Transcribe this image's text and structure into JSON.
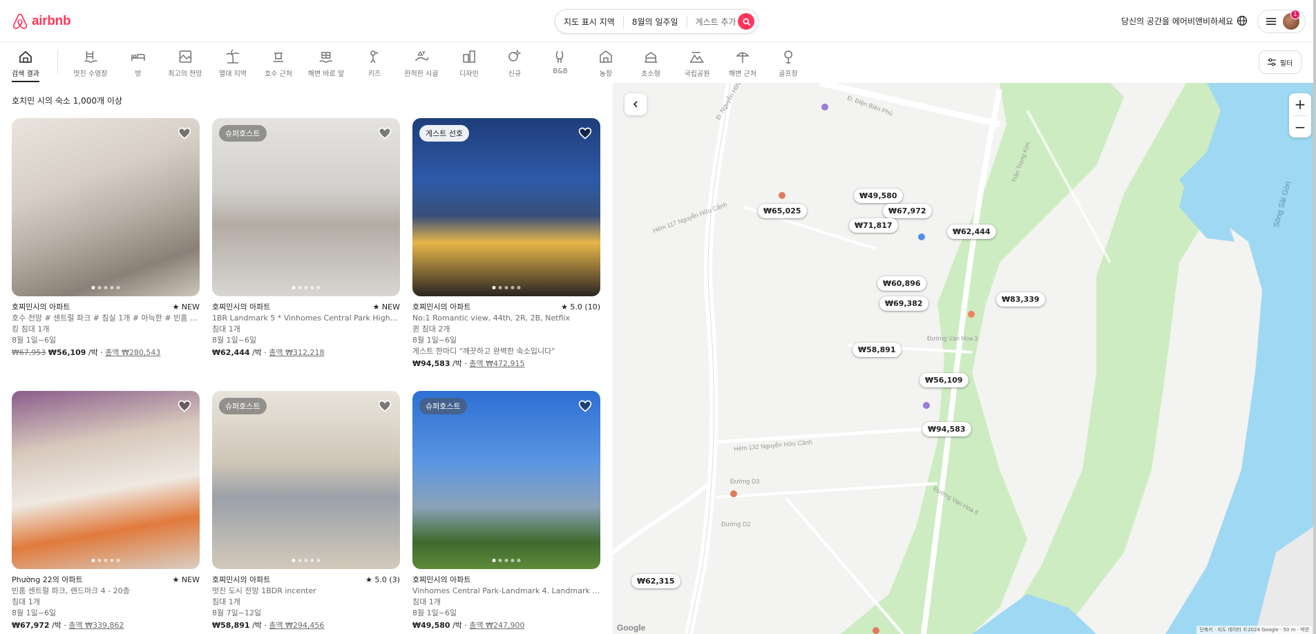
{
  "brand": {
    "name": "airbnb",
    "color": "#ff385c"
  },
  "search": {
    "location": "지도 표시 지역",
    "dates": "8월의 일주일",
    "guests": "게스트 추가"
  },
  "header": {
    "host_link": "당신의 공간을 에어비앤비하세요",
    "notification_count": "1"
  },
  "categories": [
    {
      "label": "검색 결과",
      "icon": "search-results-icon",
      "active": true
    },
    {
      "label": "멋진 수영장",
      "icon": "pool-icon"
    },
    {
      "label": "방",
      "icon": "bed-icon"
    },
    {
      "label": "최고의 전망",
      "icon": "view-icon"
    },
    {
      "label": "열대 지역",
      "icon": "palm-icon"
    },
    {
      "label": "호수 근처",
      "icon": "lake-icon"
    },
    {
      "label": "해변 바로 앞",
      "icon": "beachfront-icon"
    },
    {
      "label": "키즈",
      "icon": "kids-icon"
    },
    {
      "label": "한적한 시골",
      "icon": "countryside-icon"
    },
    {
      "label": "디자인",
      "icon": "design-icon"
    },
    {
      "label": "신규",
      "icon": "new-icon"
    },
    {
      "label": "B&B",
      "icon": "bnb-icon"
    },
    {
      "label": "농장",
      "icon": "farm-icon"
    },
    {
      "label": "초소형",
      "icon": "tiny-home-icon"
    },
    {
      "label": "국립공원",
      "icon": "national-park-icon"
    },
    {
      "label": "해변 근처",
      "icon": "beach-icon"
    },
    {
      "label": "골프장",
      "icon": "golf-icon"
    }
  ],
  "filter_label": "필터",
  "results_count": "호치민 시의 숙소 1,000개 이상",
  "listings": [
    {
      "title": "호찌민시의 아파트",
      "rating": "★ NEW",
      "desc": "호수 전망 # 센트럴 파크 # 침실 1개 # 아늑한 # 빈홈 #...",
      "beds": "킹 침대 1개",
      "dates": "8월 1일~6일",
      "old_price": "₩67,953",
      "price": "₩56,109",
      "per": " /박 · ",
      "total": "총액 ₩280,543",
      "badge": ""
    },
    {
      "title": "호찌민시의 아파트",
      "rating": "★ NEW",
      "desc": "1BR Landmark 5 * Vinhomes Central Park High Floor",
      "beds": "침대 1개",
      "dates": "8월 1일~6일",
      "old_price": "",
      "price": "₩62,444",
      "per": " /박 · ",
      "total": "총액 ₩312,218",
      "badge": "슈퍼호스트"
    },
    {
      "title": "호찌민시의 아파트",
      "rating": "★ 5.0 (10)",
      "desc": "No:1 Romantic view, 44th, 2R, 2B, Netflix",
      "beds": "퀸 침대 2개",
      "dates": "8월 1일~6일",
      "extra": "게스트 한마디 \"깨끗하고 완벽한 숙소입니다\"",
      "old_price": "",
      "price": "₩94,583",
      "per": " /박 · ",
      "total": "총액 ₩472,915",
      "badge": "게스트 선호"
    },
    {
      "title": "Phường 22의 아파트",
      "rating": "★ NEW",
      "desc": "빈홈 센트럴 파크, 랜드마크 4 - 20층",
      "beds": "침대 1개",
      "dates": "8월 1일~6일",
      "old_price": "",
      "price": "₩67,972",
      "per": " /박 · ",
      "total": "총액 ₩339,862",
      "badge": ""
    },
    {
      "title": "호찌민시의 아파트",
      "rating": "★ 5.0 (3)",
      "desc": "멋진 도시 전망 1BDR incenter",
      "beds": "침대 1개",
      "dates": "8월 7일~12일",
      "old_price": "",
      "price": "₩58,891",
      "per": " /박 · ",
      "total": "총액 ₩294,456",
      "badge": "슈퍼호스트"
    },
    {
      "title": "호찌민시의 아파트",
      "rating": "",
      "desc": "Vinhomes Central Park-Landmark 4. Landmark 81...",
      "beds": "침대 1개",
      "dates": "8월 1일~6일",
      "old_price": "",
      "price": "₩49,580",
      "per": " /박 · ",
      "total": "총액 ₩247,900",
      "badge": "슈퍼호스트"
    }
  ],
  "map": {
    "pins": [
      "₩65,025",
      "₩49,580",
      "₩67,972",
      "₩71,817",
      "₩62,444",
      "₩60,896",
      "₩69,382",
      "₩83,339",
      "₩58,891",
      "₩56,109",
      "₩94,583",
      "₩62,315"
    ],
    "street_labels": [
      "Đ. Nguyễn Hữu Cảnh",
      "Đ. Điện Biên Phủ",
      "Trần Trọng Kim",
      "Hẻm 117 Nguyễn Hữu Cảnh",
      "Đường Vạn Hoa 3",
      "Hẻm 132 Nguyễn Hữu Cảnh",
      "Đường D3",
      "Đường D2",
      "Sông Sài Gòn",
      "Đường Vạn Hoa 5"
    ],
    "google": "Google",
    "attribution": "단축키 · 지도 데이터 ©2024 Google · 50 m · 약관",
    "water_color": "#9fd8f2",
    "park_color": "#cdecc2"
  }
}
